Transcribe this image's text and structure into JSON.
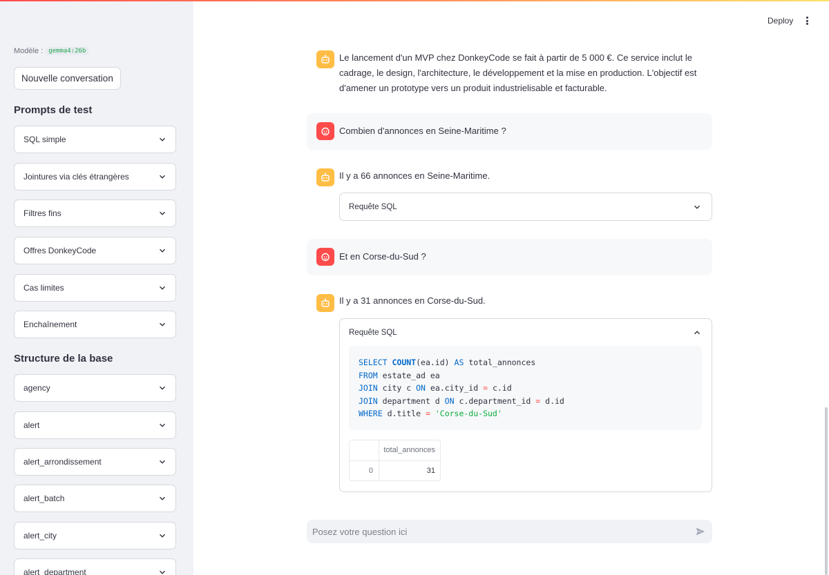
{
  "header": {
    "deploy_label": "Deploy"
  },
  "sidebar": {
    "model_label": "Modèle :",
    "model_value": "gemma4:26b",
    "new_conversation": "Nouvelle conversation",
    "prompts_heading": "Prompts de test",
    "prompts": [
      "SQL simple",
      "Jointures via clés étrangères",
      "Filtres fins",
      "Offres DonkeyCode",
      "Cas limites",
      "Enchaînement"
    ],
    "schema_heading": "Structure de la base",
    "tables": [
      "agency",
      "alert",
      "alert_arrondissement",
      "alert_batch",
      "alert_city",
      "alert_department"
    ]
  },
  "chat": {
    "messages": [
      {
        "role": "assistant",
        "text": "Le lancement d'un MVP chez DonkeyCode se fait à partir de 5 000 €. Ce service inclut le cadrage, le design, l'architecture, le développement et la mise en production. L'objectif est d'amener un prototype vers un produit industrielisable et facturable."
      },
      {
        "role": "user",
        "text": "Combien d'annonces en Seine-Maritime ?"
      },
      {
        "role": "assistant",
        "text": "Il y a 66 annonces en Seine-Maritime.",
        "expander_label": "Requête SQL"
      },
      {
        "role": "user",
        "text": "Et en Corse-du-Sud ?"
      },
      {
        "role": "assistant",
        "text": "Il y a 31 annonces en Corse-du-Sud.",
        "expander_label": "Requête SQL"
      }
    ],
    "sql": {
      "kw_select": "SELECT",
      "fn_count": "COUNT",
      "count_arg": "(ea.id)",
      "kw_as": "AS",
      "alias": "total_annonces",
      "kw_from": "FROM",
      "from_table": "estate_ad ea",
      "kw_join1": "JOIN",
      "join1_table": "city c",
      "kw_on1": "ON",
      "join1_left": "ea.city_id",
      "eq": "=",
      "join1_right": "c.id",
      "kw_join2": "JOIN",
      "join2_table": "department d",
      "kw_on2": "ON",
      "join2_left": "c.department_id",
      "join2_right": "d.id",
      "kw_where": "WHERE",
      "where_left": "d.title",
      "where_value": "'Corse-du-Sud'"
    },
    "result_table": {
      "column": "total_annonces",
      "index": "0",
      "value": "31"
    },
    "input_placeholder": "Posez votre question ici"
  }
}
